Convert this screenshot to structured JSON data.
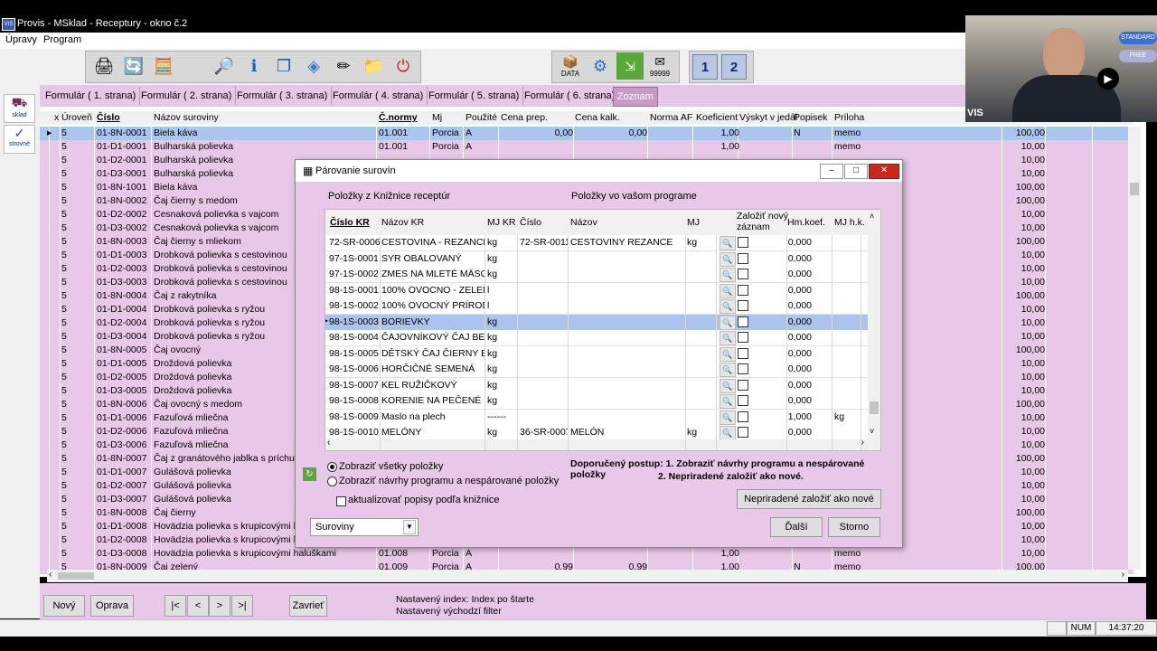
{
  "window": {
    "title": "Provis - MSklad - Receptury - okno č.2",
    "logo_text": "VIS"
  },
  "menu": [
    "Úpravy",
    "Program"
  ],
  "toolbar": {
    "data_label": "DATA",
    "counter_label": "99999",
    "btn1_label": "1",
    "btn2_label": "2"
  },
  "left_strip": {
    "btn1_label": "sklad",
    "btn2_label": "strovné"
  },
  "tabs": [
    "Formulár ( 1. strana)",
    "Formulár ( 2. strana)",
    "Formulár ( 3. strana)",
    "Formulár ( 4. strana)",
    "Formulár ( 5. strana)",
    "Formulár ( 6. strana)",
    "Zoznam"
  ],
  "grid": {
    "headers": {
      "x": "x",
      "uroven": "Úroveň",
      "cislo": "Číslo",
      "nazov": "Názov suroviny",
      "cnormy": "Č.normy",
      "mj": "Mj",
      "pouzite": "Použité",
      "cena_prep": "Cena prep.",
      "cena_kalk": "Cena kalk.",
      "norma_af": "Norma AF",
      "koef": "Koeficient",
      "vyskyt": "Výskyt v jedál",
      "popisek": "Popisek",
      "priloha": "Príloha"
    },
    "rows": [
      {
        "u": "5",
        "c": "01-8N-0001",
        "n": "Biela káva",
        "cn": "01.001",
        "mj": "Porcia",
        "p": "A",
        "cp": "0,00",
        "ck": "0,00",
        "k": "1,00",
        "pop": "N",
        "pr": "memo",
        "last": "100,00"
      },
      {
        "u": "5",
        "c": "01-D1-0001",
        "n": "Bulharská polievka",
        "cn": "01.001",
        "mj": "Porcia",
        "p": "A",
        "cp": "",
        "ck": "",
        "k": "1,00",
        "pop": "",
        "pr": "memo",
        "last": "10,00"
      },
      {
        "u": "5",
        "c": "01-D2-0001",
        "n": "Bulharská polievka",
        "cn": "",
        "mj": "",
        "p": "",
        "cp": "",
        "ck": "",
        "k": "",
        "pop": "",
        "pr": "",
        "last": "10,00"
      },
      {
        "u": "5",
        "c": "01-D3-0001",
        "n": "Bulharská polievka",
        "cn": "",
        "mj": "",
        "p": "",
        "cp": "",
        "ck": "",
        "k": "",
        "pop": "",
        "pr": "",
        "last": "10,00"
      },
      {
        "u": "5",
        "c": "01-8N-1001",
        "n": "Biela káva",
        "cn": "",
        "mj": "",
        "p": "",
        "cp": "",
        "ck": "",
        "k": "",
        "pop": "",
        "pr": "",
        "last": "100,00"
      },
      {
        "u": "5",
        "c": "01-8N-0002",
        "n": "Čaj čierny s medom",
        "cn": "",
        "mj": "",
        "p": "",
        "cp": "",
        "ck": "",
        "k": "",
        "pop": "",
        "pr": "",
        "last": "100,00"
      },
      {
        "u": "5",
        "c": "01-D2-0002",
        "n": "Cesnaková polievka s vajcom",
        "cn": "",
        "mj": "",
        "p": "",
        "cp": "",
        "ck": "",
        "k": "",
        "pop": "",
        "pr": "",
        "last": "10,00"
      },
      {
        "u": "5",
        "c": "01-D3-0002",
        "n": "Cesnaková polievka s vajcom",
        "cn": "",
        "mj": "",
        "p": "",
        "cp": "",
        "ck": "",
        "k": "",
        "pop": "",
        "pr": "",
        "last": "10,00"
      },
      {
        "u": "5",
        "c": "01-8N-0003",
        "n": "Čaj čierny s mliekom",
        "cn": "",
        "mj": "",
        "p": "",
        "cp": "",
        "ck": "",
        "k": "",
        "pop": "",
        "pr": "",
        "last": "100,00"
      },
      {
        "u": "5",
        "c": "01-D1-0003",
        "n": "Drobková polievka s cestovinou",
        "cn": "",
        "mj": "",
        "p": "",
        "cp": "",
        "ck": "",
        "k": "",
        "pop": "",
        "pr": "",
        "last": "10,00"
      },
      {
        "u": "5",
        "c": "01-D2-0003",
        "n": "Drobková polievka s cestovinou",
        "cn": "",
        "mj": "",
        "p": "",
        "cp": "",
        "ck": "",
        "k": "",
        "pop": "",
        "pr": "",
        "last": "10,00"
      },
      {
        "u": "5",
        "c": "01-D3-0003",
        "n": "Drobková polievka s cestovinou",
        "cn": "",
        "mj": "",
        "p": "",
        "cp": "",
        "ck": "",
        "k": "",
        "pop": "",
        "pr": "",
        "last": "10,00"
      },
      {
        "u": "5",
        "c": "01-8N-0004",
        "n": "Čaj z rakytníka",
        "cn": "",
        "mj": "",
        "p": "",
        "cp": "",
        "ck": "",
        "k": "",
        "pop": "",
        "pr": "",
        "last": "100,00"
      },
      {
        "u": "5",
        "c": "01-D1-0004",
        "n": "Drobková polievka s ryžou",
        "cn": "",
        "mj": "",
        "p": "",
        "cp": "",
        "ck": "",
        "k": "",
        "pop": "",
        "pr": "",
        "last": "10,00"
      },
      {
        "u": "5",
        "c": "01-D2-0004",
        "n": "Drobková polievka s ryžou",
        "cn": "",
        "mj": "",
        "p": "",
        "cp": "",
        "ck": "",
        "k": "",
        "pop": "",
        "pr": "",
        "last": "10,00"
      },
      {
        "u": "5",
        "c": "01-D3-0004",
        "n": "Drobková polievka s ryžou",
        "cn": "",
        "mj": "",
        "p": "",
        "cp": "",
        "ck": "",
        "k": "",
        "pop": "",
        "pr": "",
        "last": "10,00"
      },
      {
        "u": "5",
        "c": "01-8N-0005",
        "n": "Čaj ovocný",
        "cn": "",
        "mj": "",
        "p": "",
        "cp": "",
        "ck": "",
        "k": "",
        "pop": "",
        "pr": "",
        "last": "100,00"
      },
      {
        "u": "5",
        "c": "01-D1-0005",
        "n": "Droždová polievka",
        "cn": "",
        "mj": "",
        "p": "",
        "cp": "",
        "ck": "",
        "k": "",
        "pop": "",
        "pr": "",
        "last": "10,00"
      },
      {
        "u": "5",
        "c": "01-D2-0005",
        "n": "Droždová polievka",
        "cn": "",
        "mj": "",
        "p": "",
        "cp": "",
        "ck": "",
        "k": "",
        "pop": "",
        "pr": "",
        "last": "10,00"
      },
      {
        "u": "5",
        "c": "01-D3-0005",
        "n": "Droždová polievka",
        "cn": "",
        "mj": "",
        "p": "",
        "cp": "",
        "ck": "",
        "k": "",
        "pop": "",
        "pr": "",
        "last": "10,00"
      },
      {
        "u": "5",
        "c": "01-8N-0006",
        "n": "Čaj ovocný s medom",
        "cn": "",
        "mj": "",
        "p": "",
        "cp": "",
        "ck": "",
        "k": "",
        "pop": "",
        "pr": "",
        "last": "100,00"
      },
      {
        "u": "5",
        "c": "01-D1-0006",
        "n": "Fazuľová mliečna",
        "cn": "",
        "mj": "",
        "p": "",
        "cp": "",
        "ck": "",
        "k": "",
        "pop": "",
        "pr": "",
        "last": "10,00"
      },
      {
        "u": "5",
        "c": "01-D2-0006",
        "n": "Fazuľová mliečna",
        "cn": "",
        "mj": "",
        "p": "",
        "cp": "",
        "ck": "",
        "k": "",
        "pop": "",
        "pr": "",
        "last": "10,00"
      },
      {
        "u": "5",
        "c": "01-D3-0006",
        "n": "Fazuľová mliečna",
        "cn": "",
        "mj": "",
        "p": "",
        "cp": "",
        "ck": "",
        "k": "",
        "pop": "",
        "pr": "",
        "last": "10,00"
      },
      {
        "u": "5",
        "c": "01-8N-0007",
        "n": "Čaj z granátového jablka s príchut",
        "cn": "",
        "mj": "",
        "p": "",
        "cp": "",
        "ck": "",
        "k": "",
        "pop": "",
        "pr": "",
        "last": "100,00"
      },
      {
        "u": "5",
        "c": "01-D1-0007",
        "n": "Gulášová polievka",
        "cn": "",
        "mj": "",
        "p": "",
        "cp": "",
        "ck": "",
        "k": "",
        "pop": "",
        "pr": "",
        "last": "10,00"
      },
      {
        "u": "5",
        "c": "01-D2-0007",
        "n": "Gulášová polievka",
        "cn": "",
        "mj": "",
        "p": "",
        "cp": "",
        "ck": "",
        "k": "",
        "pop": "",
        "pr": "",
        "last": "10,00"
      },
      {
        "u": "5",
        "c": "01-D3-0007",
        "n": "Gulášová polievka",
        "cn": "",
        "mj": "",
        "p": "",
        "cp": "",
        "ck": "",
        "k": "",
        "pop": "",
        "pr": "",
        "last": "10,00"
      },
      {
        "u": "5",
        "c": "01-8N-0008",
        "n": "Čaj čierny",
        "cn": "",
        "mj": "",
        "p": "",
        "cp": "",
        "ck": "",
        "k": "",
        "pop": "",
        "pr": "",
        "last": "100,00"
      },
      {
        "u": "5",
        "c": "01-D1-0008",
        "n": "Hovädzia polievka s krupicovými h",
        "cn": "",
        "mj": "",
        "p": "",
        "cp": "",
        "ck": "",
        "k": "",
        "pop": "",
        "pr": "",
        "last": "10,00"
      },
      {
        "u": "5",
        "c": "01-D2-0008",
        "n": "Hovädzia polievka s krupicovými h",
        "cn": "",
        "mj": "",
        "p": "",
        "cp": "",
        "ck": "",
        "k": "",
        "pop": "",
        "pr": "",
        "last": "10,00"
      },
      {
        "u": "5",
        "c": "01-D3-0008",
        "n": "Hovädzia polievka s krupicovými haluškami",
        "cn": "01.008",
        "mj": "Porcia",
        "p": "A",
        "cp": "",
        "ck": "",
        "k": "1,00",
        "pop": "",
        "pr": "memo",
        "last": "10,00"
      },
      {
        "u": "5",
        "c": "01-8N-0009",
        "n": "Čaj zelený",
        "cn": "01.009",
        "mj": "Porcia",
        "p": "A",
        "cp": "0,99",
        "ck": "0,99",
        "k": "1,00",
        "pop": "N",
        "pr": "memo",
        "last": "100,00"
      }
    ]
  },
  "bottom": {
    "novy": "Nový",
    "oprava": "Oprava",
    "first": "|<",
    "prev": "<",
    "next": ">",
    "last": ">|",
    "zavriet": "Zavrieť",
    "index_info": "Nastavený index: Index po štarte",
    "filter_info": "Nastavený východzí filter"
  },
  "status": {
    "num": "NUM",
    "time": "14:37:20"
  },
  "webcam": {
    "badge1": "STANDARD",
    "badge2": "FREE",
    "overlay_text": "VIS"
  },
  "dialog": {
    "title": "Párovanie surovín",
    "left_caption": "Položky z Knižnice receptúr",
    "right_caption": "Položky vo vašom programe",
    "headers": {
      "cislo_kr": "Číslo KR",
      "nazov_kr": "Názov KR",
      "mj_kr": "MJ KR",
      "cislo": "Číslo",
      "nazov": "Názov",
      "mj": "MJ",
      "zalozit": "Založiť nový záznam",
      "hm_koef": "Hm.koef.",
      "mj_hk": "MJ h.k."
    },
    "rows": [
      {
        "ckr": "72-SR-0006",
        "nkr": "CESTOVINA - REZANCE",
        "mjkr": "kg",
        "c": "72-SR-0011",
        "n": "CESTOVINY REZANCE",
        "mj": "kg",
        "hk": "0,000",
        "mjhk": ""
      },
      {
        "ckr": "97-1S-0001",
        "nkr": "SYR OBALOVANÝ",
        "mjkr": "kg",
        "c": "",
        "n": "",
        "mj": "",
        "hk": "0,000",
        "mjhk": ""
      },
      {
        "ckr": "97-1S-0002",
        "nkr": "ZMES NA MLETÉ MÄSO S",
        "mjkr": "kg",
        "c": "",
        "n": "",
        "mj": "",
        "hk": "0,000",
        "mjhk": ""
      },
      {
        "ckr": "98-1S-0001",
        "nkr": "100% OVOCNO - ZELENI",
        "mjkr": "l",
        "c": "",
        "n": "",
        "mj": "",
        "hk": "0,000",
        "mjhk": ""
      },
      {
        "ckr": "98-1S-0002",
        "nkr": "100% OVOCNÝ PRÍRODN",
        "mjkr": "l",
        "c": "",
        "n": "",
        "mj": "",
        "hk": "0,000",
        "mjhk": ""
      },
      {
        "ckr": "98-1S-0003",
        "nkr": "BORIEVKY",
        "mjkr": "kg",
        "c": "",
        "n": "",
        "mj": "",
        "hk": "0,000",
        "mjhk": ""
      },
      {
        "ckr": "98-1S-0004",
        "nkr": "ČAJOVNÍKOVÝ ČAJ BEZ",
        "mjkr": "kg",
        "c": "",
        "n": "",
        "mj": "",
        "hk": "0,000",
        "mjhk": ""
      },
      {
        "ckr": "98-1S-0005",
        "nkr": "DĚTSKÝ ČAJ ČIERNY BE",
        "mjkr": "kg",
        "c": "",
        "n": "",
        "mj": "",
        "hk": "0,000",
        "mjhk": ""
      },
      {
        "ckr": "98-1S-0006",
        "nkr": "HORČIČNÉ SEMENÁ",
        "mjkr": "kg",
        "c": "",
        "n": "",
        "mj": "",
        "hk": "0,000",
        "mjhk": ""
      },
      {
        "ckr": "98-1S-0007",
        "nkr": "KEL RUŽIČKOVÝ",
        "mjkr": "kg",
        "c": "",
        "n": "",
        "mj": "",
        "hk": "0,000",
        "mjhk": ""
      },
      {
        "ckr": "98-1S-0008",
        "nkr": "KORENIE NA PEČENÉ M",
        "mjkr": "kg",
        "c": "",
        "n": "",
        "mj": "",
        "hk": "0,000",
        "mjhk": ""
      },
      {
        "ckr": "98-1S-0009",
        "nkr": "Maslo na plech",
        "mjkr": "------",
        "c": "",
        "n": "",
        "mj": "",
        "hk": "1,000",
        "mjhk": "kg"
      },
      {
        "ckr": "98-1S-0010",
        "nkr": "MELÓNY",
        "mjkr": "kg",
        "c": "36-SR-0007",
        "n": "MELÓN",
        "mj": "kg",
        "hk": "0,000",
        "mjhk": ""
      }
    ],
    "radio_all": "Zobraziť všetky položky",
    "radio_suggest": "Zobraziť návrhy programu a nespárované položky",
    "checkbox_update": "aktualizovať popisy podľa knižnice",
    "recommend1": "Doporučený postup: 1. Zobraziť návrhy programu a nespárované položky",
    "recommend2": "2. Nepriradené založiť ako nové.",
    "btn_create": "Nepriradené založiť ako nové",
    "dropdown": "Suroviny",
    "btn_next": "Ďalší",
    "btn_cancel": "Storno"
  }
}
